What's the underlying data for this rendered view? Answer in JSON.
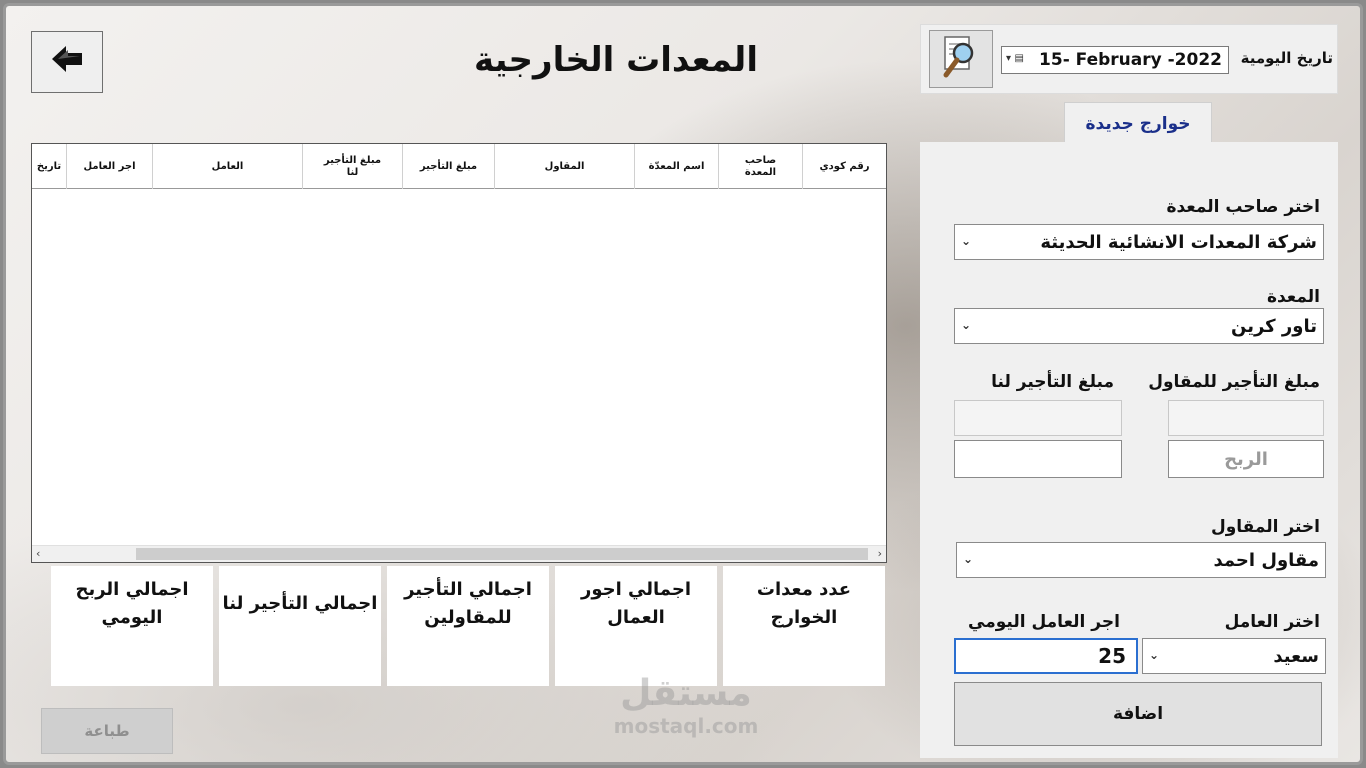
{
  "page_title": "المعدات الخارجية",
  "back_icon": "arrow-left-icon",
  "date_panel": {
    "label": "تاريخ اليومية",
    "date_value": "15- February -2022",
    "search_icon": "magnifier-document-icon"
  },
  "tab": {
    "label": "خوارج جديدة"
  },
  "form": {
    "owner_label": "اختر صاحب المعدة",
    "owner_value": "شركة المعدات الانشائية الحديثة",
    "equipment_label": "المعدة",
    "equipment_value": "تاور كرين",
    "rent_contractor_label": "مبلغ التأجير للمقاول",
    "rent_us_label": "مبلغ التأجير لنا",
    "profit_placeholder": "الربح",
    "contractor_label": "اختر المقاول",
    "contractor_value": "مقاول احمد",
    "worker_label": "اختر العامل",
    "worker_value": "سعيد",
    "worker_wage_label": "اجر العامل اليومي",
    "worker_wage_value": "25",
    "add_button": "اضافة"
  },
  "grid": {
    "columns": [
      "رقم كودي",
      "صاحب\nالمعدة",
      "اسم المعدّة",
      "المقاول",
      "مبلغ التأجير",
      "مبلغ التأجير\nلنا",
      "العامل",
      "اجر العامل",
      "تاريخ"
    ],
    "rows": []
  },
  "totals": {
    "count_label": "عدد معدات\nالخوارج",
    "wages_label": "اجمالي اجور\nالعمال",
    "rent_contractors_label": "اجمالي التأجير\nللمقاولين",
    "rent_us_label": "اجمالي التأجير لنا",
    "profit_label": "اجمالي الربح\nاليومي"
  },
  "print_button": "طباعة",
  "watermark": {
    "arabic": "مستقل",
    "latin": "mostaql.com"
  }
}
